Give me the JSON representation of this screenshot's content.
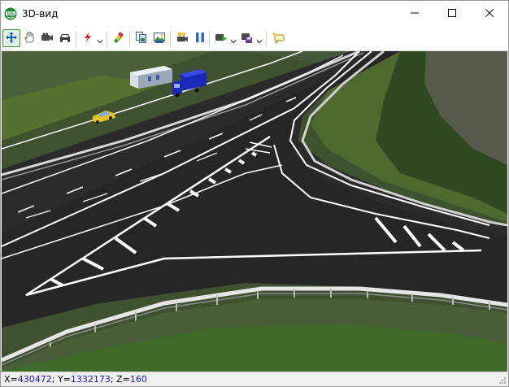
{
  "window": {
    "title": "3D-вид",
    "app_icon": "gis-globe-icon",
    "controls": [
      "minimize-icon",
      "maximize-icon",
      "close-icon"
    ]
  },
  "toolbar": {
    "buttons": [
      {
        "name": "move-tool",
        "icon": "move-arrows-icon",
        "active": true
      },
      {
        "name": "pan-hand",
        "icon": "hand-icon"
      },
      {
        "name": "camera",
        "icon": "video-camera-icon"
      },
      {
        "name": "car-view",
        "icon": "car-icon"
      },
      {
        "name": "effects",
        "icon": "lightning-icon",
        "dropdown": true
      },
      {
        "name": "layers",
        "icon": "layers-icon"
      },
      {
        "name": "copy-view",
        "icon": "copy-icon"
      },
      {
        "name": "export-image",
        "icon": "picture-icon"
      },
      {
        "name": "record",
        "icon": "record-camera-icon"
      },
      {
        "name": "pause",
        "icon": "pause-icon"
      },
      {
        "name": "play-recording",
        "icon": "film-play-icon",
        "dropdown": true
      },
      {
        "name": "save-recording",
        "icon": "film-save-icon",
        "dropdown": true
      },
      {
        "name": "comment",
        "icon": "callout-icon"
      }
    ]
  },
  "viewport": {
    "scene": "3d-road-interchange"
  },
  "status": {
    "x_label": "X=",
    "x_value": "430472",
    "y_label": "; Y=",
    "y_value": "1332173",
    "z_label": "; Z=",
    "z_value": "160"
  },
  "colors": {
    "accent_blue": "#1a1adc",
    "active_tool_border": "#3a8a3a",
    "asphalt": "#2b2b2b",
    "grass": "#4d6a2e"
  }
}
